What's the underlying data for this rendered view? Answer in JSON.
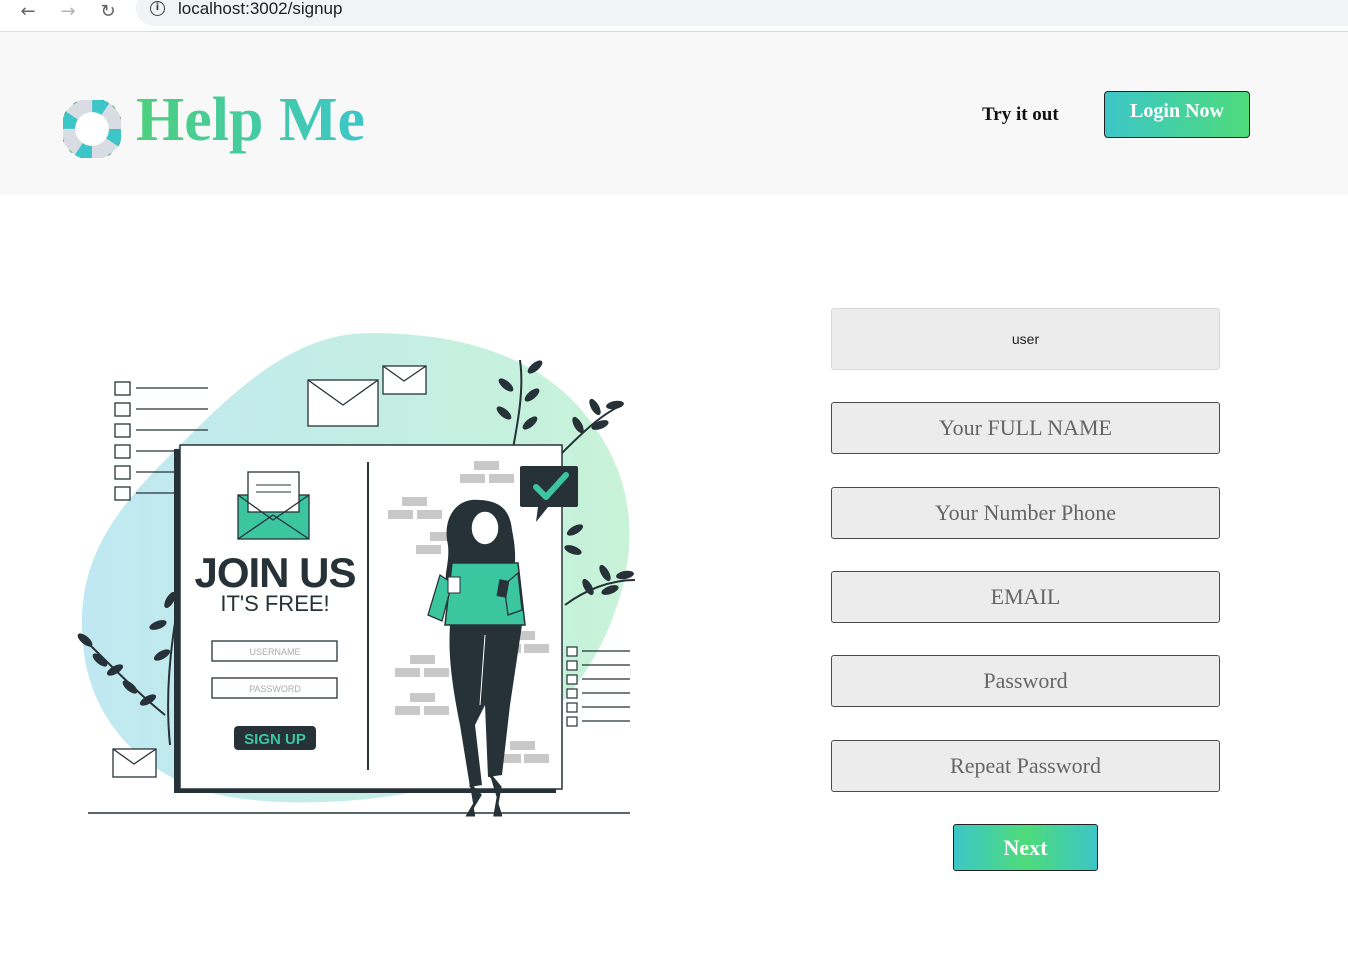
{
  "browser": {
    "url": "localhost:3002/signup"
  },
  "header": {
    "brand": "Help Me",
    "try_link": "Try it out",
    "login_button": "Login Now"
  },
  "illustration": {
    "heading": "JOIN US",
    "subheading": "IT'S FREE!",
    "username_label": "USERNAME",
    "password_label": "PASSWORD",
    "signup_button": "SIGN UP"
  },
  "form": {
    "username_value": "user",
    "full_name_placeholder": "Your FULL NAME",
    "phone_placeholder": "Your Number Phone",
    "email_placeholder": "EMAIL",
    "password_placeholder": "Password",
    "repeat_password_placeholder": "Repeat Password",
    "next_button": "Next"
  },
  "colors": {
    "brand_green": "#4ed07c",
    "brand_teal": "#3cc6c8",
    "header_bg": "#f8f8f8",
    "field_bg": "#ececec"
  }
}
